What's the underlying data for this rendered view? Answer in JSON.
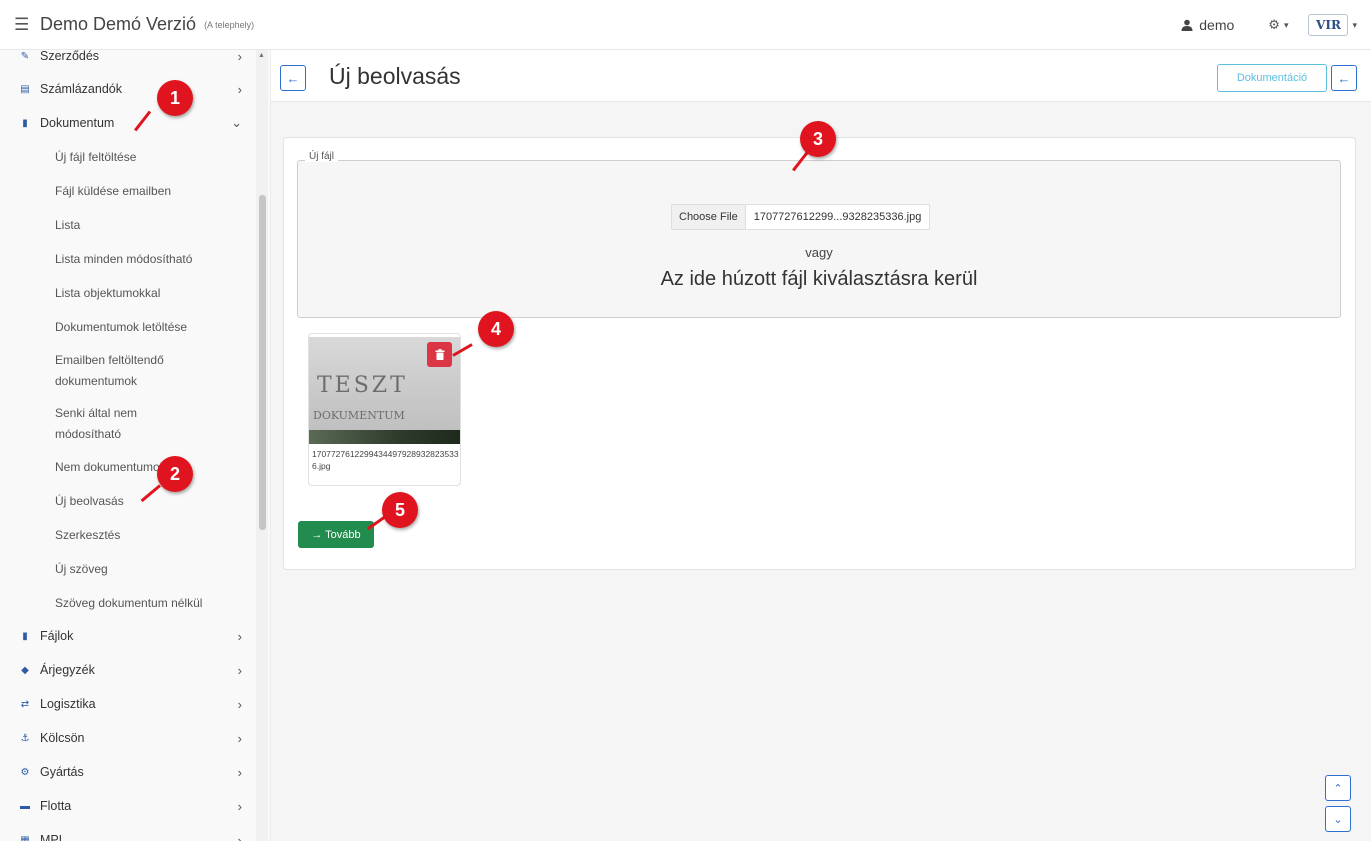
{
  "topbar": {
    "title": "Demo Demó Verzió",
    "subtitle": "(A telephely)",
    "user": "demo",
    "logo_text": "VIR"
  },
  "sidebar": {
    "items_top": [
      {
        "label": "Szerződés",
        "icon": "contract-icon"
      },
      {
        "label": "Számlázandók",
        "icon": "invoice-icon"
      },
      {
        "label": "Dokumentum",
        "icon": "document-icon",
        "expanded": true
      }
    ],
    "sub_items": [
      "Új fájl feltöltése",
      "Fájl küldése emailben",
      "Lista",
      "Lista minden módosítható",
      "Lista objektumokkal",
      "Dokumentumok letöltése",
      "Emailben feltöltendő dokumentumok",
      "Senki által nem módosítható",
      "Nem dokumentumok",
      "Új beolvasás",
      "Szerkesztés",
      "Új szöveg",
      "Szöveg dokumentum nélkül"
    ],
    "items_bottom": [
      {
        "label": "Fájlok",
        "icon": "files-icon"
      },
      {
        "label": "Árjegyzék",
        "icon": "tag-icon"
      },
      {
        "label": "Logisztika",
        "icon": "logistics-icon"
      },
      {
        "label": "Kölcsön",
        "icon": "loan-icon"
      },
      {
        "label": "Gyártás",
        "icon": "manufacturing-icon"
      },
      {
        "label": "Flotta",
        "icon": "car-icon"
      },
      {
        "label": "MPL",
        "icon": "mpl-icon"
      }
    ]
  },
  "page": {
    "title": "Új beolvasás",
    "doc_button": "Dokumentáció"
  },
  "upload": {
    "legend": "Új fájl",
    "choose_label": "Choose File",
    "chosen_file": "1707727612299...9328235336.jpg",
    "or_text": "vagy",
    "drop_text": "Az ide húzott fájl kiválasztásra kerül",
    "thumb_line1": "TESZT",
    "thumb_line2": "DOKUMENTUM",
    "thumb_filename": "17077276122994344979289328235336.jpg",
    "next_button": "→ Tovább"
  },
  "markers": [
    "1",
    "2",
    "3",
    "4",
    "5"
  ],
  "colors": {
    "accent": "#2f6fd0",
    "marker": "#e0141e",
    "success": "#218c4e",
    "danger": "#dc3545",
    "info": "#5bc0de"
  }
}
